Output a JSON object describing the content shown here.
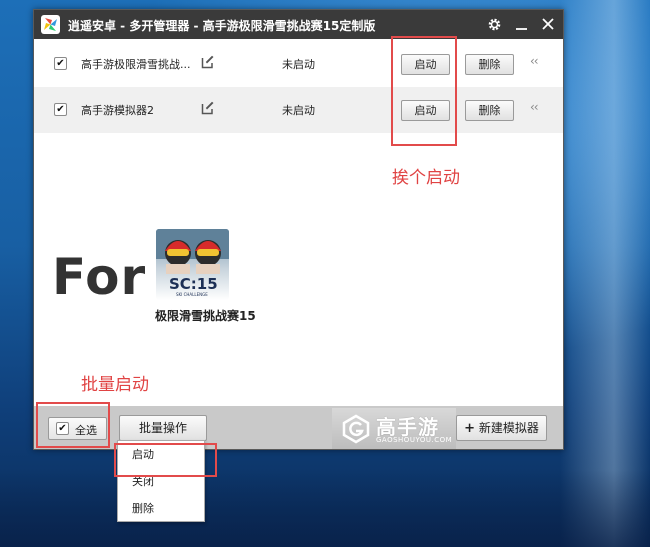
{
  "window": {
    "title": "逍遥安卓 - 多开管理器 - 高手游极限滑雪挑战赛15定制版"
  },
  "instances": [
    {
      "name": "高手游极限滑雪挑战...",
      "status": "未启动",
      "start_label": "启动",
      "delete_label": "删除",
      "checked": "✔"
    },
    {
      "name": "高手游模拟器2",
      "status": "未启动",
      "start_label": "启动",
      "delete_label": "删除",
      "checked": "✔"
    }
  ],
  "promo": {
    "for_text": "For",
    "icon_text": "SC:15",
    "icon_subtext": "SKI CHALLENGE",
    "game_name": "极限滑雪挑战赛15"
  },
  "annotations": {
    "one_by_one": "挨个启动",
    "batch": "批量启动"
  },
  "bottom": {
    "select_all_label": "全选",
    "select_all_check": "✔",
    "batch_label": "批量操作",
    "brand_name": "高手游",
    "brand_url": "GAOSHOUYOU.COM",
    "new_label": "新建模拟器"
  },
  "batch_menu": [
    "启动",
    "关闭",
    "删除"
  ],
  "colors": {
    "titlebar": "#3a3a3a",
    "annotation_red": "#e04343",
    "bottombar": "#c9c9c9"
  },
  "icons": {
    "settings": "gear-icon",
    "minimize": "minimize-icon",
    "close": "close-icon",
    "edit": "edit-icon",
    "expand": "double-chevron-left-icon",
    "new": "plus-icon"
  }
}
